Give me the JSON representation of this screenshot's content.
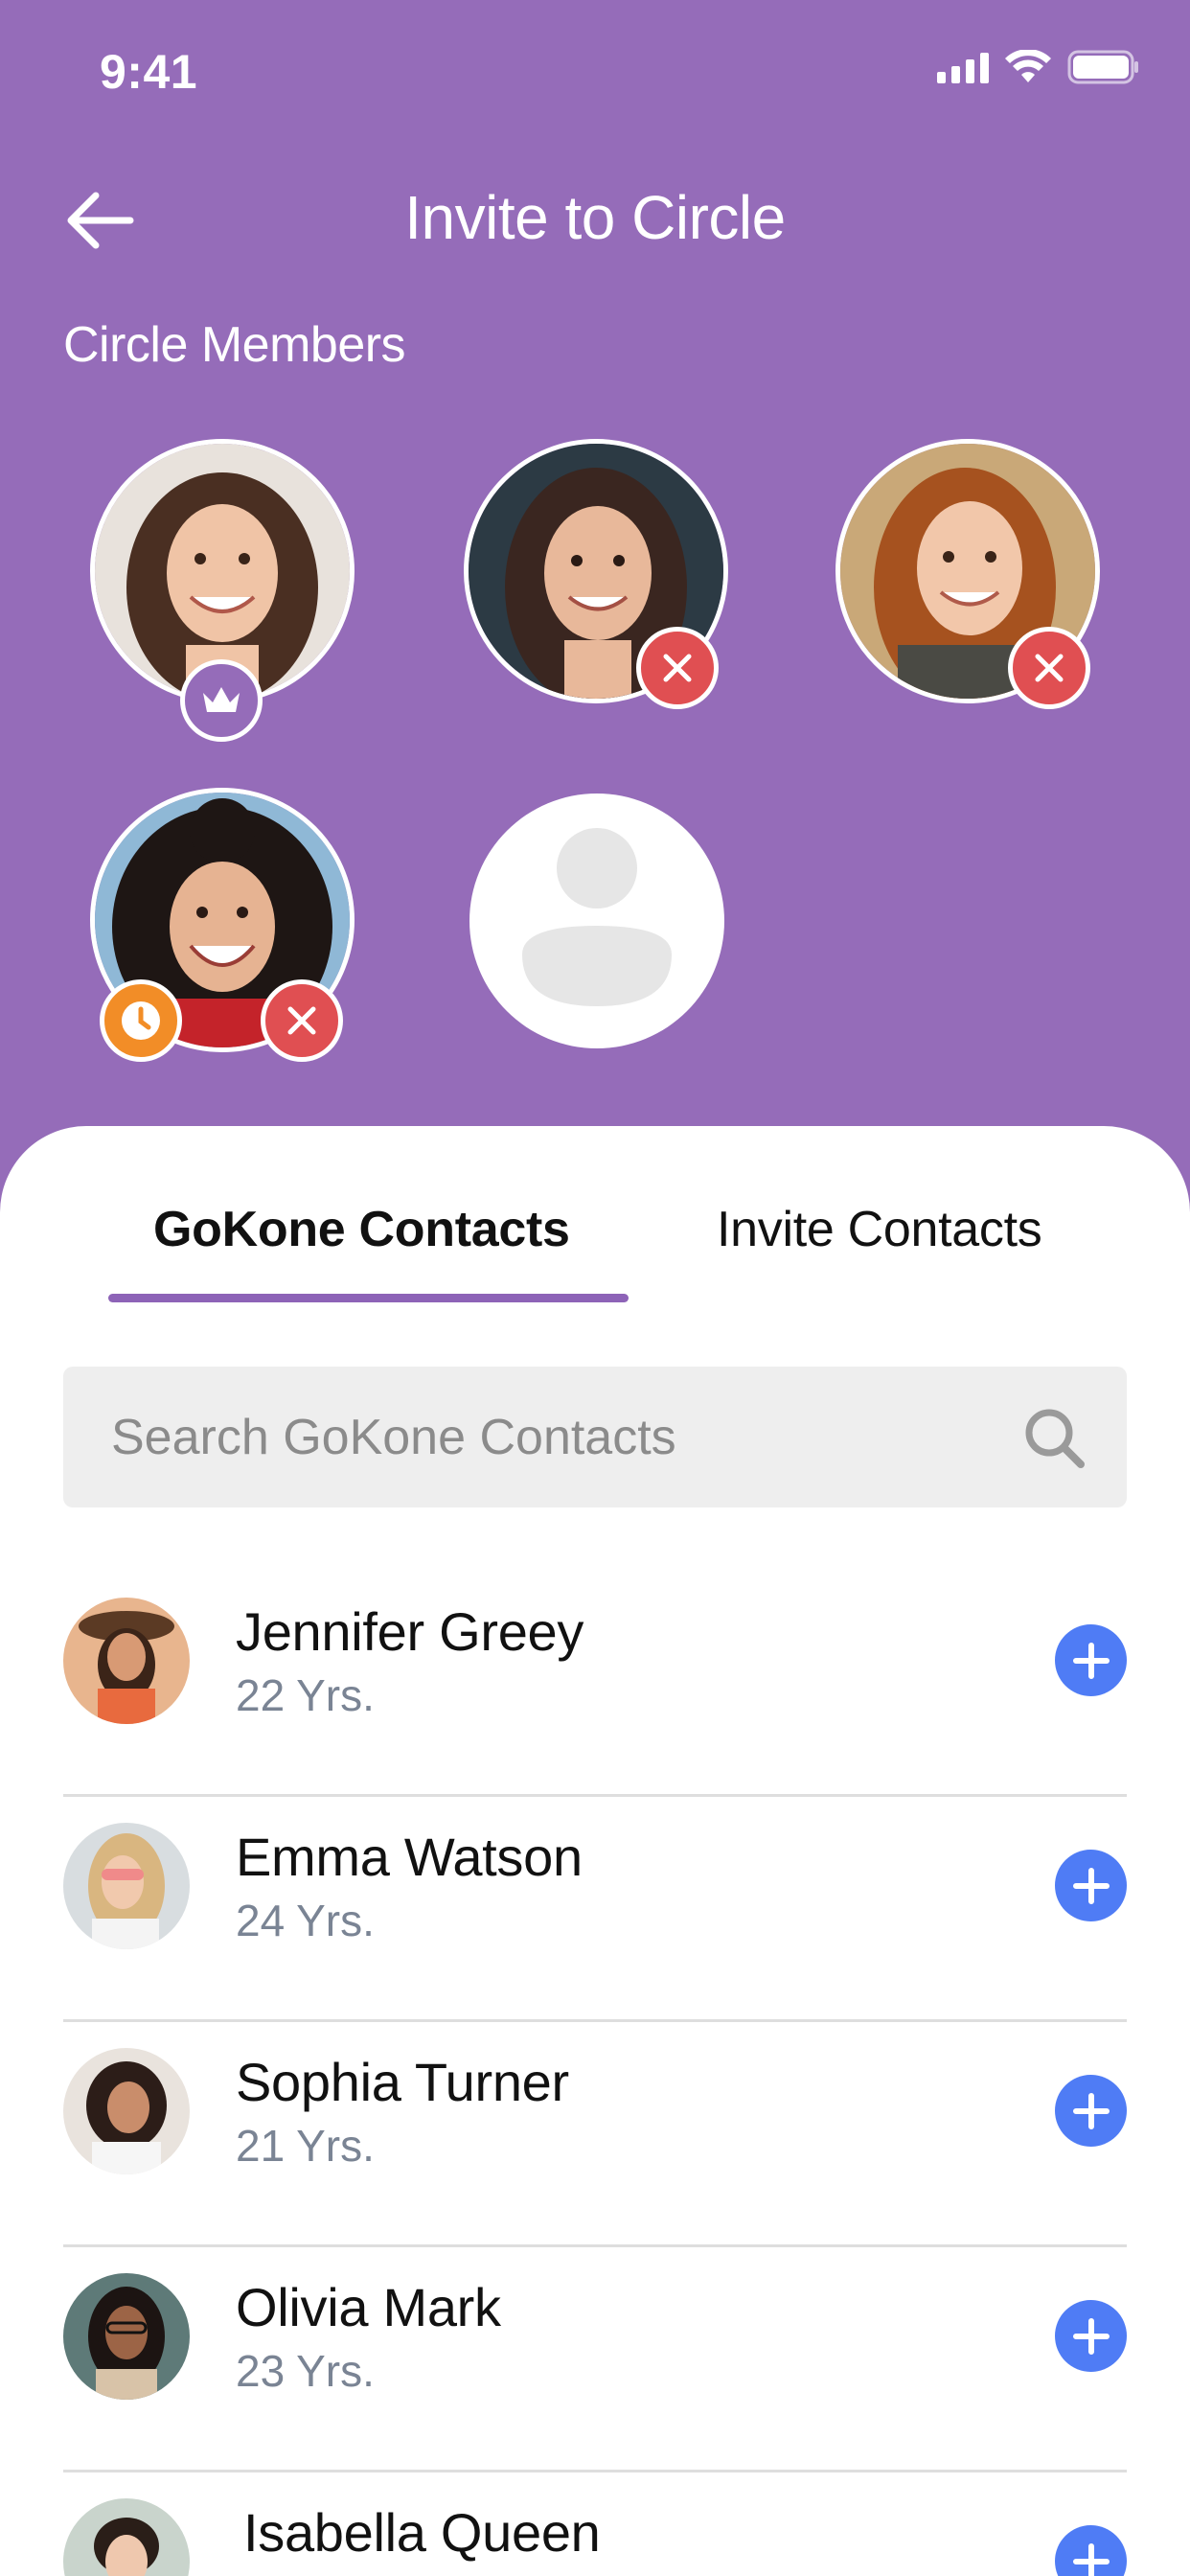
{
  "status_bar": {
    "time": "9:41"
  },
  "header": {
    "title": "Invite to Circle",
    "section_title": "Circle Members"
  },
  "members": [
    {
      "name": "member-1",
      "badge": "crown"
    },
    {
      "name": "member-2",
      "badge": "remove"
    },
    {
      "name": "member-3",
      "badge": "remove"
    },
    {
      "name": "member-4",
      "badges": [
        "clock",
        "remove"
      ]
    },
    {
      "name": "empty-slot",
      "badge": null
    }
  ],
  "tabs": [
    {
      "label": "GoKone Contacts",
      "active": true
    },
    {
      "label": "Invite Contacts",
      "active": false
    }
  ],
  "search": {
    "placeholder": "Search GoKone Contacts"
  },
  "contacts": [
    {
      "name": "Jennifer Greey",
      "age": "22 Yrs."
    },
    {
      "name": "Emma Watson",
      "age": "24 Yrs."
    },
    {
      "name": "Sophia Turner",
      "age": "21 Yrs."
    },
    {
      "name": "Olivia Mark",
      "age": "23 Yrs."
    },
    {
      "name": "Isabella Queen",
      "age": ""
    }
  ],
  "colors": {
    "header_bg": "#956cb9",
    "accent": "#8d63b7",
    "remove_badge": "#e04f52",
    "pending_badge": "#f28d27",
    "add_button": "#4f7cf5"
  }
}
